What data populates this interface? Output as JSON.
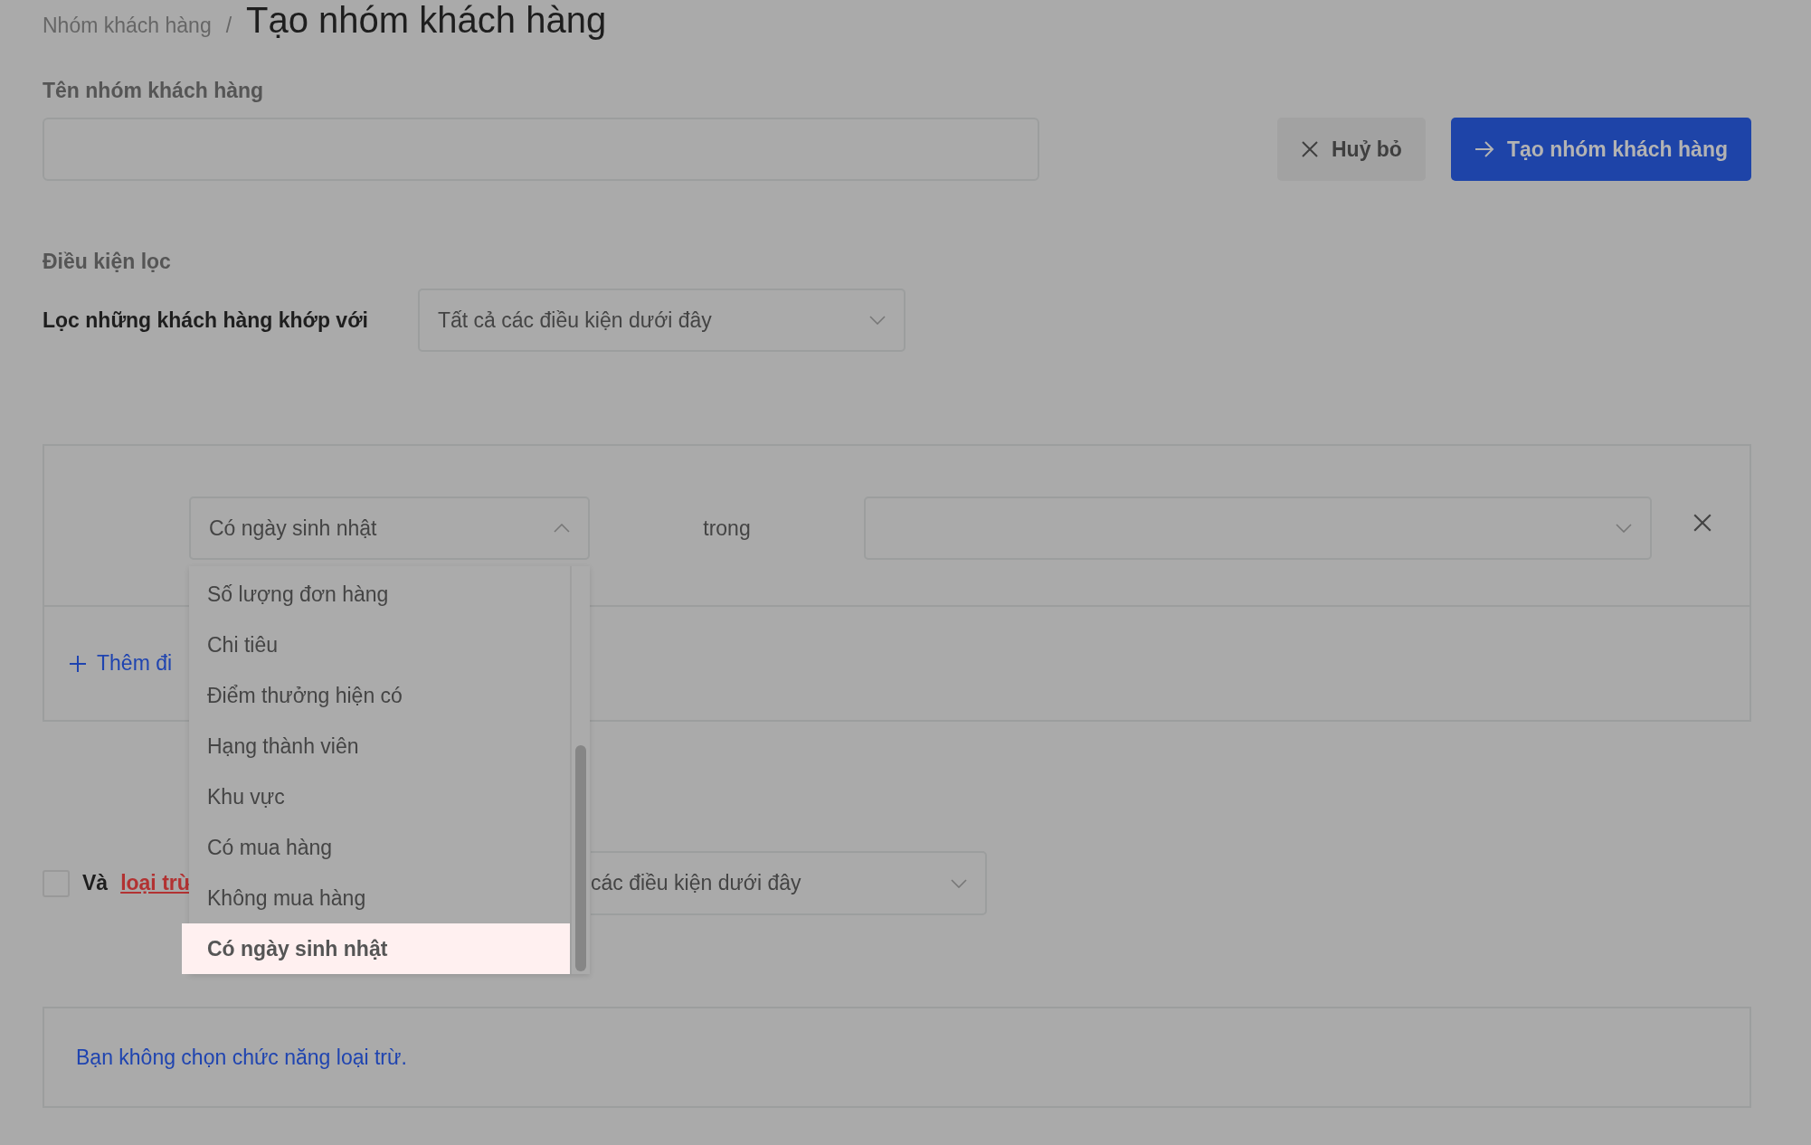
{
  "breadcrumb": {
    "parent": "Nhóm khách hàng",
    "separator": "/",
    "title": "Tạo nhóm khách hàng"
  },
  "name_field": {
    "label": "Tên nhóm khách hàng"
  },
  "buttons": [
    {
      "kind": "cancel",
      "label": "Huỷ bỏ"
    },
    {
      "kind": "primary",
      "label": "Tạo nhóm khách hàng"
    }
  ],
  "filter": {
    "section_title": "Điều kiện lọc",
    "match_label": "Lọc những khách hàng khớp với",
    "match_value": "Tất cả các điều kiện dưới đây"
  },
  "conditions": [
    {
      "field": "Có ngày sinh nhật",
      "expanded": true,
      "operator": "trong"
    }
  ],
  "add_condition": "Thêm đi",
  "dropdown_options": [
    {
      "label": "Số lượng đơn hàng",
      "selected": false
    },
    {
      "label": "Chi tiêu",
      "selected": false
    },
    {
      "label": "Điểm thưởng hiện có",
      "selected": false
    },
    {
      "label": "Hạng thành viên",
      "selected": false
    },
    {
      "label": "Khu vực",
      "selected": false
    },
    {
      "label": "Có mua hàng",
      "selected": false
    },
    {
      "label": "Không mua hàng",
      "selected": false
    },
    {
      "label": "Có ngày sinh nhật",
      "selected": true
    }
  ],
  "exclude": {
    "checked": false,
    "prefix": "Và",
    "link": "loại trừ",
    "match_value": "các điều kiện dưới đây"
  },
  "exclude_note": "Bạn không chọn chức năng loại trừ."
}
